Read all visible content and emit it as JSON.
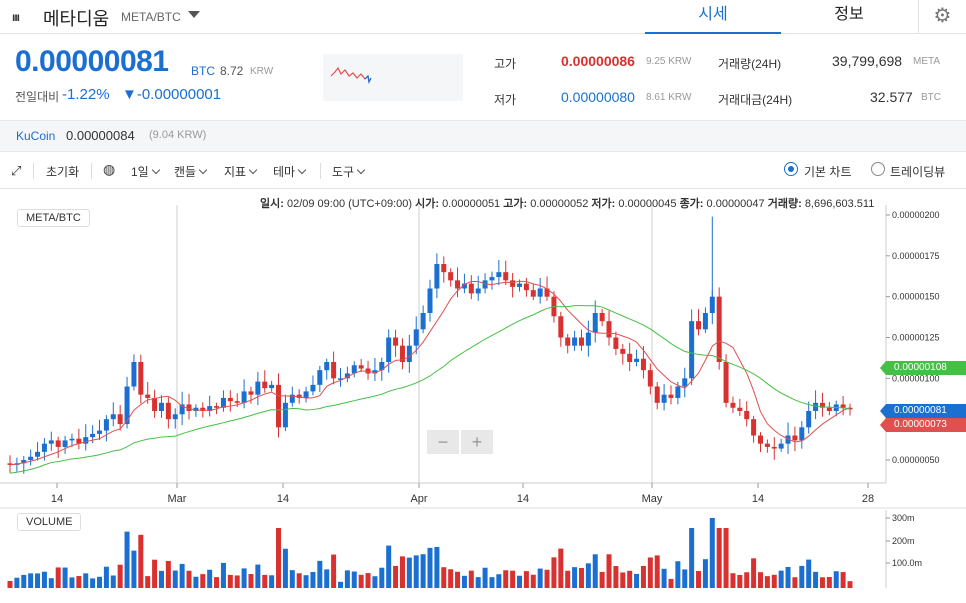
{
  "header": {
    "logo": "ııı",
    "coin_name": "메타디움",
    "coin_pair": "META/BTC",
    "tabs": {
      "price": "시세",
      "info": "정보"
    },
    "settings_icon": "gear-icon"
  },
  "price": {
    "current": "0.00000081",
    "unit": "BTC",
    "krw": "8.72",
    "krw_unit": "KRW",
    "change_label": "전일대비",
    "change_pct": "-1.22%",
    "change_abs": "▼-0.00000001"
  },
  "stats": {
    "high_label": "고가",
    "high_value": "0.00000086",
    "high_krw": "9.25 KRW",
    "low_label": "저가",
    "low_value": "0.00000080",
    "low_krw": "8.61 KRW",
    "volume_label": "거래량(24H)",
    "volume_value": "39,799,698",
    "volume_unit": "META",
    "amount_label": "거래대금(24H)",
    "amount_value": "32.577",
    "amount_unit": "BTC"
  },
  "exchange": {
    "name": "KuCoin",
    "price": "0.00000084",
    "krw": "(9.04 KRW)"
  },
  "toolbar": {
    "reset": "초기화",
    "interval": "1일",
    "candle": "캔들",
    "indicator": "지표",
    "theme": "테마",
    "tools": "도구",
    "basic_chart": "기본 차트",
    "trading_view": "트레이딩뷰"
  },
  "ohlc": {
    "date_label": "일시:",
    "date": "02/09 09:00 (UTC+09:00)",
    "open_label": "시가:",
    "open": "0.00000051",
    "high_label": "고가:",
    "high": "0.00000052",
    "low_label": "저가:",
    "low": "0.00000045",
    "close_label": "종가:",
    "close": "0.00000047",
    "vol_label": "거래량:",
    "vol": "8,696,603.511"
  },
  "chart_labels": {
    "price_pane": "META/BTC",
    "volume_pane": "VOLUME",
    "zoom_out": "−",
    "zoom_in": "+",
    "tag_ma_long": "0.00000108",
    "tag_last": "0.00000081",
    "tag_ma_short": "0.00000073"
  },
  "colors": {
    "up": "#1a6fd1",
    "down": "#d93030",
    "ma_short": "#e05050",
    "ma_long": "#44c044"
  },
  "chart_data": {
    "type": "candlestick",
    "x_ticks": [
      "14",
      "Mar",
      "14",
      "Apr",
      "14",
      "May",
      "14",
      "28"
    ],
    "y_ticks": [
      "0.00000200",
      "0.00000175",
      "0.00000150",
      "0.00000125",
      "0.00000100",
      "0.00000075",
      "0.00000050"
    ],
    "volume_ticks": [
      "300m",
      "200m",
      "100.0m"
    ],
    "close": [
      0.47,
      0.48,
      0.5,
      0.52,
      0.55,
      0.6,
      0.62,
      0.58,
      0.62,
      0.63,
      0.6,
      0.64,
      0.66,
      0.68,
      0.75,
      0.78,
      0.72,
      0.95,
      1.1,
      0.9,
      0.88,
      0.8,
      0.85,
      0.75,
      0.78,
      0.84,
      0.8,
      0.82,
      0.8,
      0.83,
      0.82,
      0.88,
      0.86,
      0.85,
      0.92,
      0.9,
      0.98,
      0.94,
      0.96,
      0.7,
      0.85,
      0.9,
      0.88,
      0.92,
      0.96,
      1.05,
      1.1,
      1.0,
      1.0,
      1.03,
      1.08,
      1.06,
      1.03,
      1.05,
      1.1,
      1.25,
      1.2,
      1.1,
      1.2,
      1.3,
      1.4,
      1.55,
      1.7,
      1.65,
      1.6,
      1.55,
      1.58,
      1.52,
      1.55,
      1.6,
      1.62,
      1.65,
      1.6,
      1.56,
      1.58,
      1.54,
      1.5,
      1.55,
      1.5,
      1.38,
      1.25,
      1.2,
      1.25,
      1.2,
      1.28,
      1.4,
      1.35,
      1.25,
      1.18,
      1.15,
      1.1,
      1.12,
      1.05,
      0.95,
      0.85,
      0.9,
      0.88,
      0.95,
      1.0,
      1.35,
      1.3,
      1.4,
      1.5,
      1.1,
      0.85,
      0.82,
      0.8,
      0.75,
      0.65,
      0.6,
      0.58,
      0.57,
      0.6,
      0.65,
      0.62,
      0.7,
      0.8,
      0.85,
      0.82,
      0.8,
      0.84,
      0.82,
      0.81
    ],
    "ma_short_color": "#e05050",
    "ma_long_color": "#44c044"
  }
}
